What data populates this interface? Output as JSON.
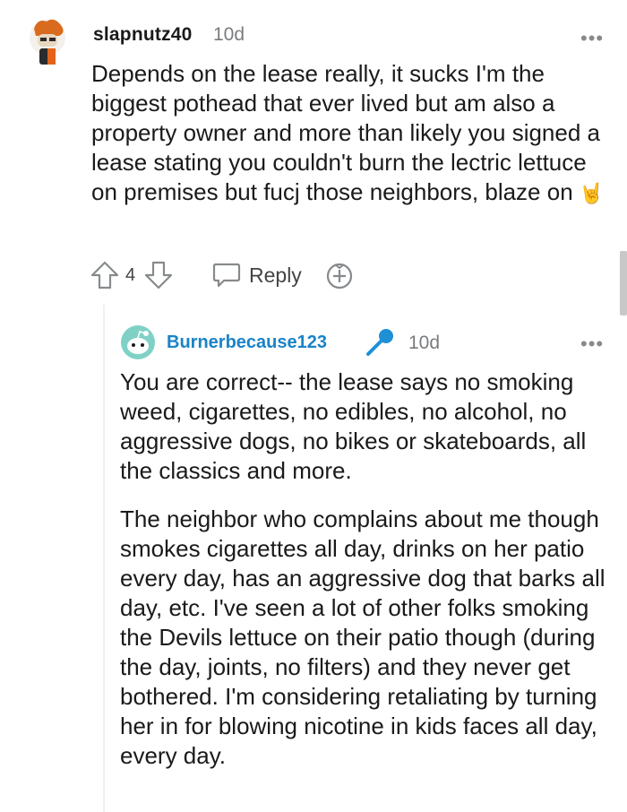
{
  "parent_comment": {
    "username": "slapnutz40",
    "time": "10d",
    "more_label": "•••",
    "body": "Depends on the lease really, it sucks I'm the biggest pothead that ever lived but am also a property owner and more than likely you signed a lease stating you couldn't burn the lectric lettuce on premises but fucj those neighbors, blaze on",
    "emoji": "🤘",
    "votes": "4",
    "reply_label": "Reply",
    "icons": [
      "avatar",
      "upvote-icon",
      "downvote-icon",
      "reply-icon",
      "award-icon"
    ]
  },
  "reply_comment": {
    "username": "Burnerbecause123",
    "time": "10d",
    "more_label": "•••",
    "paragraphs": [
      "You are correct-- the lease says no smoking weed, cigarettes, no edibles, no alcohol, no aggressive dogs, no bikes or skateboards, all the classics and more.",
      "The neighbor who complains about me though smokes cigarettes all day, drinks on her patio every day, has an aggressive dog that barks all day, etc. I've seen a lot of other folks smoking the Devils lettuce on their patio though (during the day, joints, no filters) and they never get bothered. I'm considering retaliating by turning her in for blowing nicotine in kids faces all day, every day."
    ],
    "icons": [
      "snoo-avatar",
      "microphone-icon"
    ]
  },
  "colors": {
    "username_reply": "#1a83c8",
    "meta_text": "#787c7e",
    "thread_line": "#edeff1"
  }
}
